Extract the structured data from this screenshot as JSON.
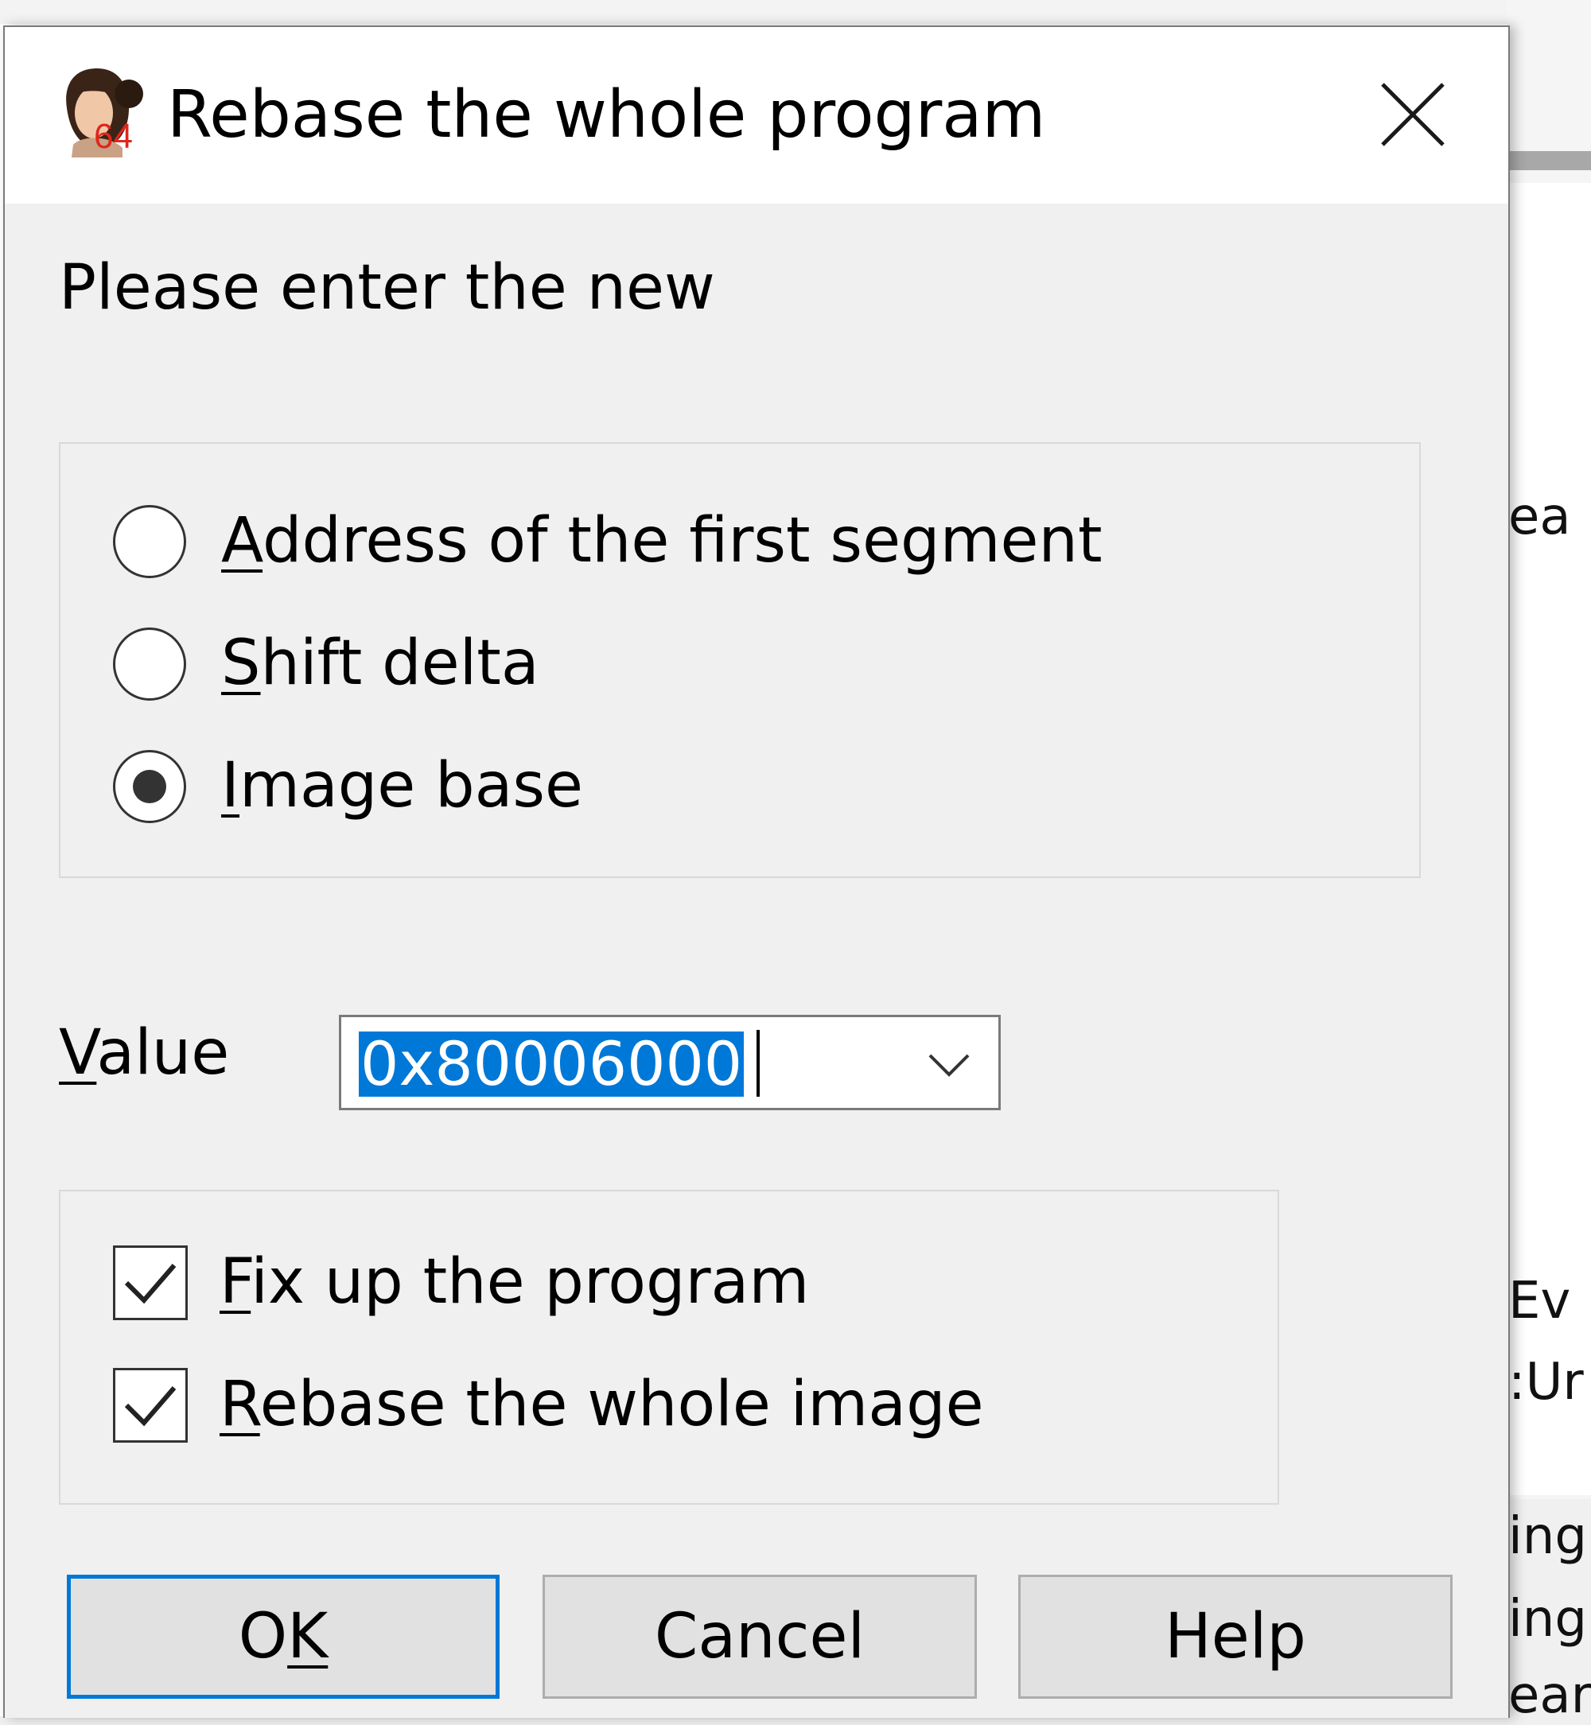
{
  "dialog": {
    "title": "Rebase the whole program",
    "prompt": "Please enter the new",
    "options": [
      {
        "before": "",
        "key": "A",
        "after": "ddress of the first segment",
        "checked": false
      },
      {
        "before": "",
        "key": "S",
        "after": "hift delta",
        "checked": false
      },
      {
        "before": "",
        "key": "I",
        "after": "mage base",
        "checked": true
      }
    ],
    "value": {
      "label_key": "V",
      "label_rest": "alue",
      "text": "0x80006000"
    },
    "checks": [
      {
        "before": "",
        "key": "F",
        "after": "ix up the program",
        "checked": true
      },
      {
        "before": "",
        "key": "R",
        "after": "ebase the whole image",
        "checked": true
      }
    ],
    "buttons": {
      "ok_before": "O",
      "ok_key": "K",
      "cancel": "Cancel",
      "help": "Help"
    },
    "icon_badge": "64"
  },
  "background": {
    "fragments": [
      "ea",
      "Ev",
      ":Ur",
      "ing",
      "ing",
      "ear"
    ]
  }
}
